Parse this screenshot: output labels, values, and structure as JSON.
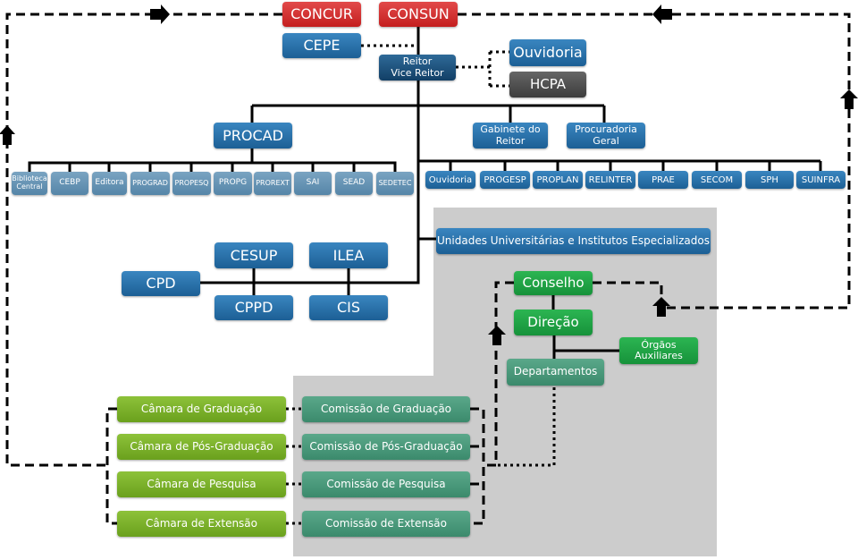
{
  "top": {
    "concur": "CONCUR",
    "consun": "CONSUN",
    "cepe": "CEPE",
    "reitor_line1": "Reitor",
    "reitor_line2": "Vice Reitor",
    "ouvidoria": "Ouvidoria",
    "hcpa": "HCPA"
  },
  "second": {
    "procad": "PROCAD",
    "gabinete_line1": "Gabinete do",
    "gabinete_line2": "Reitor",
    "procuradoria_line1": "Procuradoria",
    "procuradoria_line2": "Geral"
  },
  "procad_units": [
    "Biblioteca Central",
    "CEBP",
    "Editora",
    "PROGRAD",
    "PROPESQ",
    "PROPG",
    "PROREXT",
    "SAI",
    "SEAD",
    "SEDETEC"
  ],
  "reitoria_units": [
    "Ouvidoria",
    "PROGESP",
    "PROPLAN",
    "RELINTER",
    "PRAE",
    "SECOM",
    "SPH",
    "SUINFRA"
  ],
  "middle": {
    "unidades": "Unidades Universitárias e Institutos Especializados",
    "cesup": "CESUP",
    "ilea": "ILEA",
    "cpd": "CPD",
    "cppd": "CPPD",
    "cis": "CIS"
  },
  "unit_structure": {
    "conselho": "Conselho",
    "direcao": "Direção",
    "orgaos_line1": "Órgãos",
    "orgaos_line2": "Auxiliares",
    "departamentos": "Departamentos"
  },
  "camaras": [
    "Câmara de Graduação",
    "Câmara de Pós-Graduação",
    "Câmara de Pesquisa",
    "Câmara de Extensão"
  ],
  "comissoes": [
    "Comissão de Graduação",
    "Comissão de Pós-Graduação",
    "Comissão de Pesquisa",
    "Comissão de Extensão"
  ],
  "colors": {
    "council": "#d12f2f",
    "unit": "#2672aa",
    "subunit": "#6a97b8",
    "unit_body": "#1fa545",
    "commission": "#4a9a7b",
    "chamber": "#7db12b",
    "area": "#cccccc"
  }
}
